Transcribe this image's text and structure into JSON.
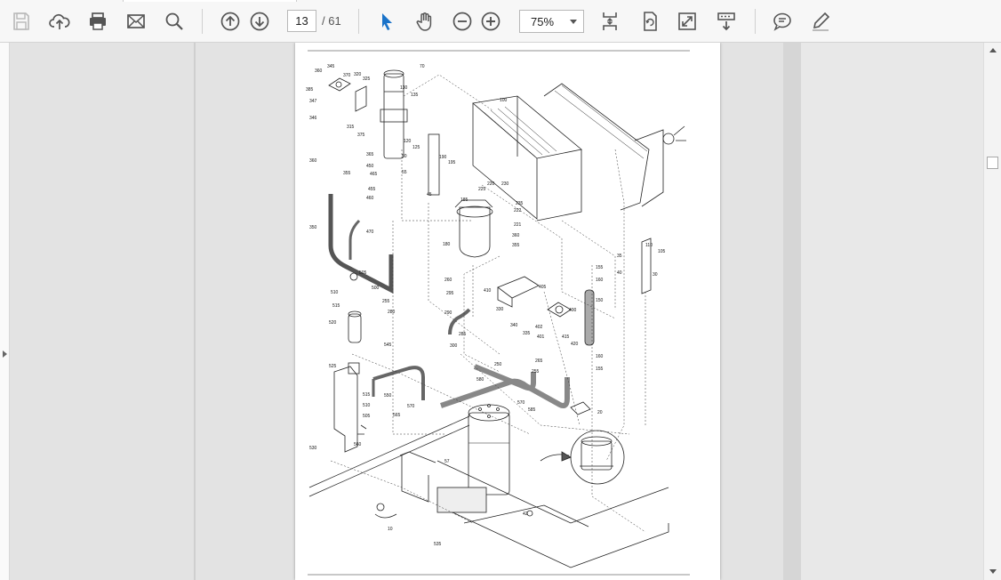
{
  "toolbar": {
    "page_number": "13",
    "page_total": "/ 61",
    "zoom": "75%",
    "icons": [
      "save-icon",
      "upload-icon",
      "print-icon",
      "email-icon",
      "search-icon",
      "prev-page-icon",
      "next-page-icon",
      "select-cursor-icon",
      "hand-tool-icon",
      "zoom-out-icon",
      "zoom-in-icon",
      "fit-page-icon",
      "rotate-icon",
      "fullscreen-icon",
      "scroll-mode-icon",
      "comment-icon",
      "highlight-icon"
    ],
    "accent": "#1a73c9"
  },
  "diagram": {
    "labels": [
      "345",
      "360",
      "370",
      "320",
      "385",
      "347",
      "346",
      "325",
      "315",
      "375",
      "130",
      "135",
      "70",
      "100",
      "120",
      "125",
      "190",
      "195",
      "50",
      "55",
      "365",
      "450",
      "465",
      "45",
      "360",
      "355",
      "455",
      "460",
      "185",
      "225",
      "220",
      "230",
      "235",
      "222",
      "221",
      "360",
      "355",
      "180",
      "350",
      "470",
      "110",
      "105",
      "35",
      "40",
      "30",
      "155",
      "160",
      "150",
      "505",
      "510",
      "500",
      "515",
      "255",
      "280",
      "520",
      "260",
      "295",
      "410",
      "405",
      "330",
      "400",
      "290",
      "285",
      "300",
      "340",
      "335",
      "402",
      "401",
      "415",
      "420",
      "160",
      "155",
      "265",
      "255",
      "250",
      "545",
      "525",
      "515",
      "510",
      "505",
      "550",
      "580",
      "570",
      "585",
      "560",
      "565",
      "570",
      "20",
      "530",
      "57",
      "42",
      "10",
      "535"
    ]
  }
}
